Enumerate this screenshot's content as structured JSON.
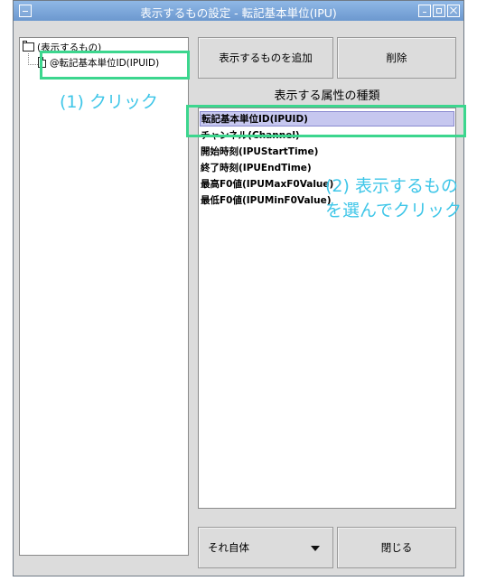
{
  "window": {
    "title": "表示するもの設定 - 転記基本単位(IPU)"
  },
  "tree": {
    "root_label": "(表示するもの)",
    "child_label": "@転記基本単位ID(IPUID)"
  },
  "buttons": {
    "add_label": "表示するものを追加",
    "delete_label": "削除",
    "close_label": "閉じる"
  },
  "attributes": {
    "heading": "表示する属性の種類",
    "items": [
      "転記基本単位ID(IPUID)",
      "チャンネル(Channel)",
      "開始時刻(IPUStartTime)",
      "終了時刻(IPUEndTime)",
      "最高F0値(IPUMaxF0Value)",
      "最低F0値(IPUMinF0Value)"
    ]
  },
  "mode_select": {
    "value": "それ自体"
  },
  "annotations": {
    "step1": "(1) クリック",
    "step2_line1": "(2) 表示するもの",
    "step2_line2": "を選んでクリック"
  },
  "colors": {
    "titlebar": "#7aa6dc",
    "highlight_box": "#3cd68e",
    "annotation_text": "#3fc6e8",
    "selection": "#c6c7ef"
  }
}
